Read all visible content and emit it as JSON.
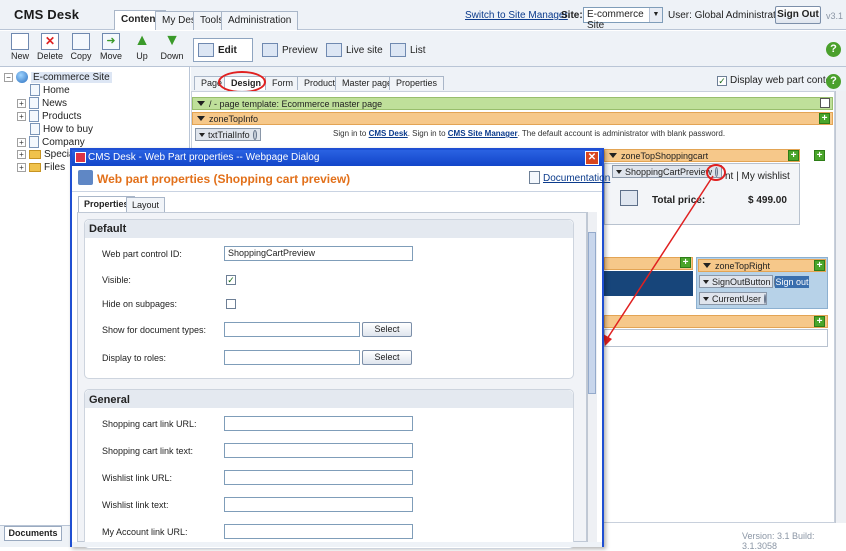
{
  "header": {
    "brand": "CMS Desk",
    "tabs": [
      "Content",
      "My Desk",
      "Tools",
      "Administration"
    ],
    "switch_link": "Switch to Site Manager",
    "site_label": "Site:",
    "site_value": "E-commerce Site",
    "user_label": "User: Global Administrator",
    "signout": "Sign Out",
    "version": "v3.1"
  },
  "toolbar": {
    "buttons": [
      "New",
      "Delete",
      "Copy",
      "Move",
      "Up",
      "Down"
    ],
    "modes": [
      "Edit",
      "Preview",
      "Live site",
      "List"
    ]
  },
  "tree": {
    "root": "E-commerce Site",
    "items": [
      "Home",
      "News",
      "Products",
      "How to buy",
      "Company",
      "Special",
      "Files"
    ]
  },
  "bottom_tab": "Documents",
  "edit_tabs": [
    "Page",
    "Design",
    "Form",
    "Product",
    "Master page",
    "Properties"
  ],
  "display_wp": "Display web part content",
  "design": {
    "template": "/ - page template: Ecommerce master page",
    "zone_top_info": "zoneTopInfo",
    "wp_trial": "txtTrialInfo",
    "trial_text_1": "Sign in to",
    "trial_link_1": "CMS Desk",
    "trial_text_2": ". Sign in to",
    "trial_link_2": "CMS Site Manager",
    "trial_text_3": ". The default account is administrator with blank password.",
    "zone_cart": "zoneTopShoppingcart",
    "wp_cart": "ShoppingCartPreview",
    "cart_links": "nt | My wishlist",
    "total_label": "Total price:",
    "total_value": "$ 499.00",
    "zone_right": "zoneTopRight",
    "wp_signout": "SignOutButton",
    "signout_label": "Sign out",
    "wp_current_user": "CurrentUser",
    "version_bottom": "Version: 3.1 Build: 3.1.3058"
  },
  "dialog": {
    "title": "CMS Desk - Web Part properties -- Webpage Dialog",
    "heading": "Web part properties (Shopping cart preview)",
    "doc_link": "Documentation",
    "tabs": [
      "Properties",
      "Layout"
    ],
    "section_default": "Default",
    "lbl_id": "Web part control ID:",
    "val_id": "ShoppingCartPreview",
    "lbl_visible": "Visible:",
    "lbl_hide": "Hide on subpages:",
    "lbl_doc_types": "Show for document types:",
    "lbl_roles": "Display to roles:",
    "select": "Select",
    "section_general": "General",
    "lbl_cart_url": "Shopping cart link URL:",
    "lbl_cart_text": "Shopping cart link text:",
    "lbl_wish_url": "Wishlist link URL:",
    "lbl_wish_text": "Wishlist link text:",
    "lbl_account_url": "My Account link URL:"
  },
  "colors": {
    "accent": "#1f4fd2",
    "heading": "#e2701a",
    "highlight": "#e02020"
  }
}
